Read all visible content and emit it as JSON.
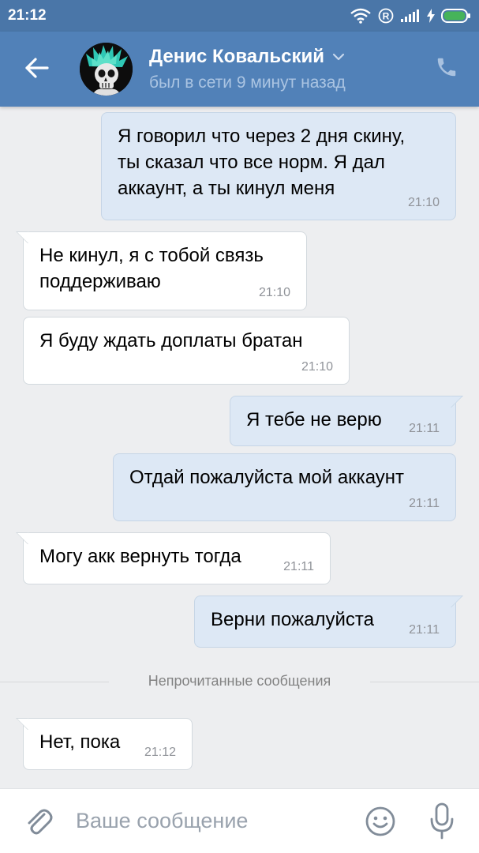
{
  "status_bar": {
    "time": "21:12"
  },
  "header": {
    "contact_name": "Денис Ковальский",
    "contact_status": "был в сети 9 минут назад"
  },
  "messages": [
    {
      "direction": "out",
      "text": "Я говорил что через 2 дня скину,\nты сказал что все норм. Я дал\nаккаунт, а ты кинул меня",
      "time": "21:10"
    },
    {
      "direction": "in",
      "text": "Не кинул, я с тобой связь\nподдерживаю",
      "time": "21:10"
    },
    {
      "direction": "in",
      "text": "Я буду ждать доплаты братан",
      "time": "21:10"
    },
    {
      "direction": "out",
      "text": "Я тебе не верю",
      "time": "21:11"
    },
    {
      "direction": "out",
      "text": "Отдай пожалуйста мой аккаунт",
      "time": "21:11"
    },
    {
      "direction": "in",
      "text": "Могу акк вернуть тогда",
      "time": "21:11"
    },
    {
      "direction": "out",
      "text": "Верни пожалуйста",
      "time": "21:11"
    },
    {
      "direction": "in",
      "text": "Нет, пока",
      "time": "21:12"
    }
  ],
  "unread_divider": "Непрочитанные сообщения",
  "input": {
    "placeholder": "Ваше сообщение"
  },
  "colors": {
    "header": "#5181b8",
    "status_bar": "#4a76a8",
    "outgoing_bubble": "#dde8f5",
    "incoming_bubble": "#ffffff",
    "chat_background": "#edeef0"
  },
  "icons": {
    "back": "arrow-left-icon",
    "chevron": "chevron-down-icon",
    "call": "phone-icon",
    "attach": "paperclip-icon",
    "emoji": "smiley-icon",
    "mic": "microphone-icon"
  }
}
